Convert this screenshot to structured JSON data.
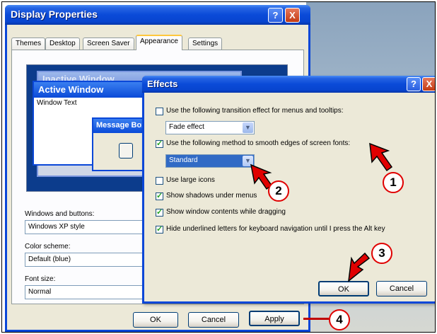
{
  "main_dialog": {
    "title": "Display Properties",
    "help_button": "?",
    "close_button": "X",
    "tabs": [
      "Themes",
      "Desktop",
      "Screen Saver",
      "Appearance",
      "Settings"
    ],
    "active_tab": "Appearance",
    "preview": {
      "inactive_window": "Inactive Window",
      "active_window": "Active Window",
      "window_text": "Window Text",
      "message_box": "Message Box"
    },
    "windows_and_buttons_label": "Windows and buttons:",
    "windows_and_buttons_value": "Windows XP style",
    "color_scheme_label": "Color scheme:",
    "color_scheme_value": "Default (blue)",
    "font_size_label": "Font size:",
    "font_size_value": "Normal",
    "ok_button": "OK",
    "cancel_button": "Cancel",
    "apply_button": "Apply"
  },
  "effects_dialog": {
    "title": "Effects",
    "help_button": "?",
    "close_button": "X",
    "options": [
      {
        "label": "Use the following transition effect for menus and tooltips:",
        "checked": false
      },
      {
        "label": "Use the following method to smooth edges of screen fonts:",
        "checked": true
      },
      {
        "label": "Use large icons",
        "checked": false
      },
      {
        "label": "Show shadows under menus",
        "checked": true
      },
      {
        "label": "Show window contents while dragging",
        "checked": true
      },
      {
        "label": "Hide underlined letters for keyboard navigation until I press the Alt key",
        "checked": true
      }
    ],
    "transition_effect_value": "Fade effect",
    "smoothing_method_value": "Standard",
    "ok_button": "OK",
    "cancel_button": "Cancel"
  },
  "annotations": {
    "step1": "1",
    "step2": "2",
    "step3": "3",
    "step4": "4",
    "accent_color": "#e00000"
  }
}
